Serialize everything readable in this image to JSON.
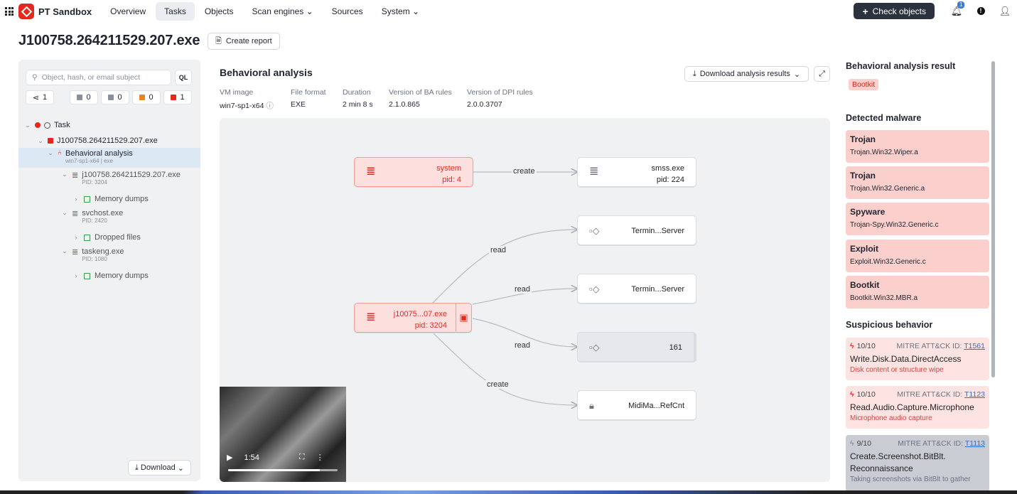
{
  "app": {
    "brand": "PT Sandbox"
  },
  "nav": [
    {
      "label": "Overview"
    },
    {
      "label": "Tasks"
    },
    {
      "label": "Objects"
    },
    {
      "label": "Scan engines",
      "dropdown": true
    },
    {
      "label": "Sources"
    },
    {
      "label": "System",
      "dropdown": true
    }
  ],
  "topbar": {
    "check_objects": "Check objects",
    "notifications": "1"
  },
  "page": {
    "title": "J100758.264211529.207.exe",
    "create_report": "Create report"
  },
  "left": {
    "search_placeholder": "Object, hash, or email subject",
    "ql": "QL",
    "counts": [
      "1",
      "0",
      "0",
      "0",
      "1"
    ],
    "download": "Download",
    "tree": {
      "task": "Task",
      "file": "J100758.264211529.207.exe",
      "ba": "Behavioral analysis",
      "ba_sub": "win7-sp1-x64",
      "ba_tag": "exe",
      "p1": "j100758.264211529.207.exe",
      "p1_pid": "PID: 3204",
      "p1_child": "Memory dumps",
      "p2": "svchost.exe",
      "p2_pid": "PID: 2420",
      "p2_child": "Dropped files",
      "p3": "taskeng.exe",
      "p3_pid": "PID: 1080",
      "p3_child": "Memory dumps"
    }
  },
  "ba": {
    "title": "Behavioral analysis",
    "download_results": "Download analysis results",
    "meta": [
      {
        "k": "VM image",
        "v": "win7-sp1-x64"
      },
      {
        "k": "File format",
        "v": "EXE"
      },
      {
        "k": "Duration",
        "v": "2 min 8 s"
      },
      {
        "k": "Version of BA rules",
        "v": "2.1.0.865"
      },
      {
        "k": "Version of DPI rules",
        "v": "2.0.0.3707"
      }
    ],
    "graph": {
      "nodes": {
        "system": {
          "name": "system",
          "pid": "pid: 4"
        },
        "smss": {
          "name": "smss.exe",
          "pid": "pid: 224"
        },
        "term1": {
          "name": "Termin...Server"
        },
        "term2": {
          "name": "Termin...Server"
        },
        "main": {
          "name": "j10075...07.exe",
          "pid": "pid: 3204"
        },
        "n161": {
          "name": "161"
        },
        "midi": {
          "name": "MidiMa...RefCnt"
        }
      },
      "edges": [
        "create",
        "read",
        "read",
        "read",
        "create"
      ]
    },
    "video": {
      "time": "1:54",
      "progress": 0.84
    }
  },
  "right": {
    "result_title": "Behavioral analysis result",
    "result_tag": "Bootkit",
    "malware_title": "Detected malware",
    "malware": [
      {
        "type": "Trojan",
        "name": "Trojan.Win32.Wiper.a"
      },
      {
        "type": "Trojan",
        "name": "Trojan.Win32.Generic.a"
      },
      {
        "type": "Spyware",
        "name": "Trojan-Spy.Win32.Generic.c"
      },
      {
        "type": "Exploit",
        "name": "Exploit.Win32.Generic.c"
      },
      {
        "type": "Bootkit",
        "name": "Bootkit.Win32.MBR.a"
      }
    ],
    "susp_title": "Suspicious behavior",
    "mitre_label": "MITRE ATT&CK ID:",
    "susp": [
      {
        "score": "10",
        "of": "/10",
        "id": "T1561",
        "name": "Write.Disk.Data.DirectAccess",
        "desc": "Disk content or structure wipe"
      },
      {
        "score": "10",
        "of": "/10",
        "id": "T1123",
        "name": "Read.Audio.Capture.Microphone",
        "desc": "Microphone audio capture"
      },
      {
        "score": "9",
        "of": "/10",
        "id": "T1113",
        "name": "Create.Screenshot.BitBlt. Reconnaissance",
        "desc": "Taking screenshots via BitBlt to gather"
      }
    ]
  },
  "colors": {
    "accent": "#e5281f",
    "dark": "#2b323e",
    "link": "#2e6fcf"
  }
}
